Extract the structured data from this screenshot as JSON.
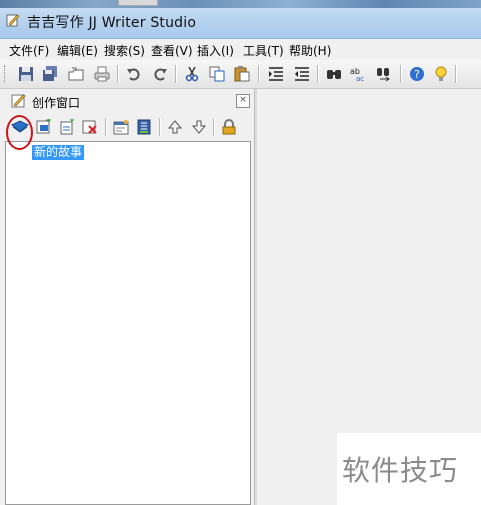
{
  "window": {
    "title": "吉吉写作 JJ Writer Studio"
  },
  "menu": [
    "文件(F)",
    "编辑(E)",
    "搜索(S)",
    "查看(V)",
    "插入(I)",
    "工具(T)",
    "帮助(H)"
  ],
  "toolbar_icons": [
    "save-icon",
    "save-all-icon",
    "open-icon",
    "print-icon",
    "undo-icon",
    "redo-icon",
    "cut-icon",
    "copy-icon",
    "paste-icon",
    "indent-icon",
    "outdent-icon",
    "find-icon",
    "replace-icon",
    "find-next-icon",
    "help-icon",
    "tip-icon"
  ],
  "panel": {
    "title": "创作窗口",
    "close_glyph": "×",
    "tools": [
      "new-story-icon",
      "new-chapter-icon",
      "new-section-icon",
      "delete-icon",
      "properties-icon",
      "notes-icon",
      "move-up-icon",
      "move-down-icon",
      "lock-icon"
    ]
  },
  "tree": {
    "items": [
      "新的故事"
    ]
  },
  "watermark": "软件技巧",
  "colors": {
    "selection": "#3399ff",
    "highlight_circle": "#c8141a"
  }
}
